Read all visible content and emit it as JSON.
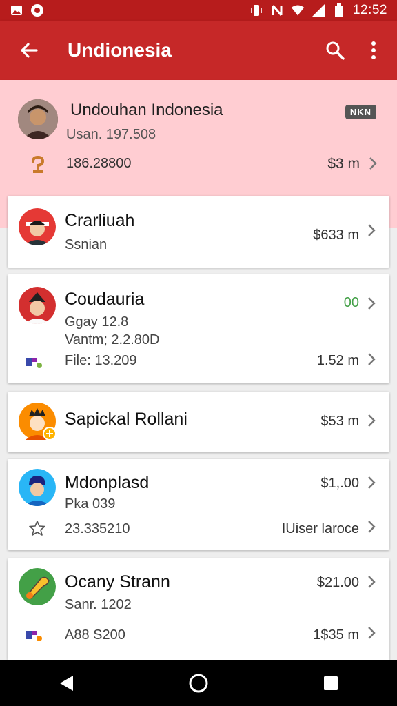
{
  "status_bar": {
    "time": "12:52"
  },
  "app_bar": {
    "title": "Undionesia"
  },
  "header": {
    "name": "Undouhan Indonesia",
    "sub": "Usan. 197.508",
    "badge": "NKN",
    "id": "186.28800",
    "amount": "$3 m"
  },
  "items": [
    {
      "title": "Crarliuah",
      "sub": "Ssnian",
      "right": "$633 m"
    },
    {
      "title": "Coudauria",
      "sub": "Ggay 12.8",
      "sub2": "Vantm; 2.2.80D",
      "right": "00",
      "row2_label": "File: 13.209",
      "row2_right": "1.52 m"
    },
    {
      "title": "Sapickal Rollani",
      "right": "$53 m"
    },
    {
      "title": "Mdonplasd",
      "sub": "Pka 039",
      "right": "$1,.00",
      "row2_label": "23.335210",
      "row2_right": "IUiser laroce"
    },
    {
      "title": "Ocany Strann",
      "sub": "Sanr. 1202",
      "right": "$21.00",
      "row2_label": "A88 S200",
      "row2_right": "1$35 m"
    }
  ],
  "colors": {
    "primary": "#c62828",
    "status": "#b71c1c",
    "header_bg": "#ffcdd2",
    "accent_green": "#43a047"
  }
}
